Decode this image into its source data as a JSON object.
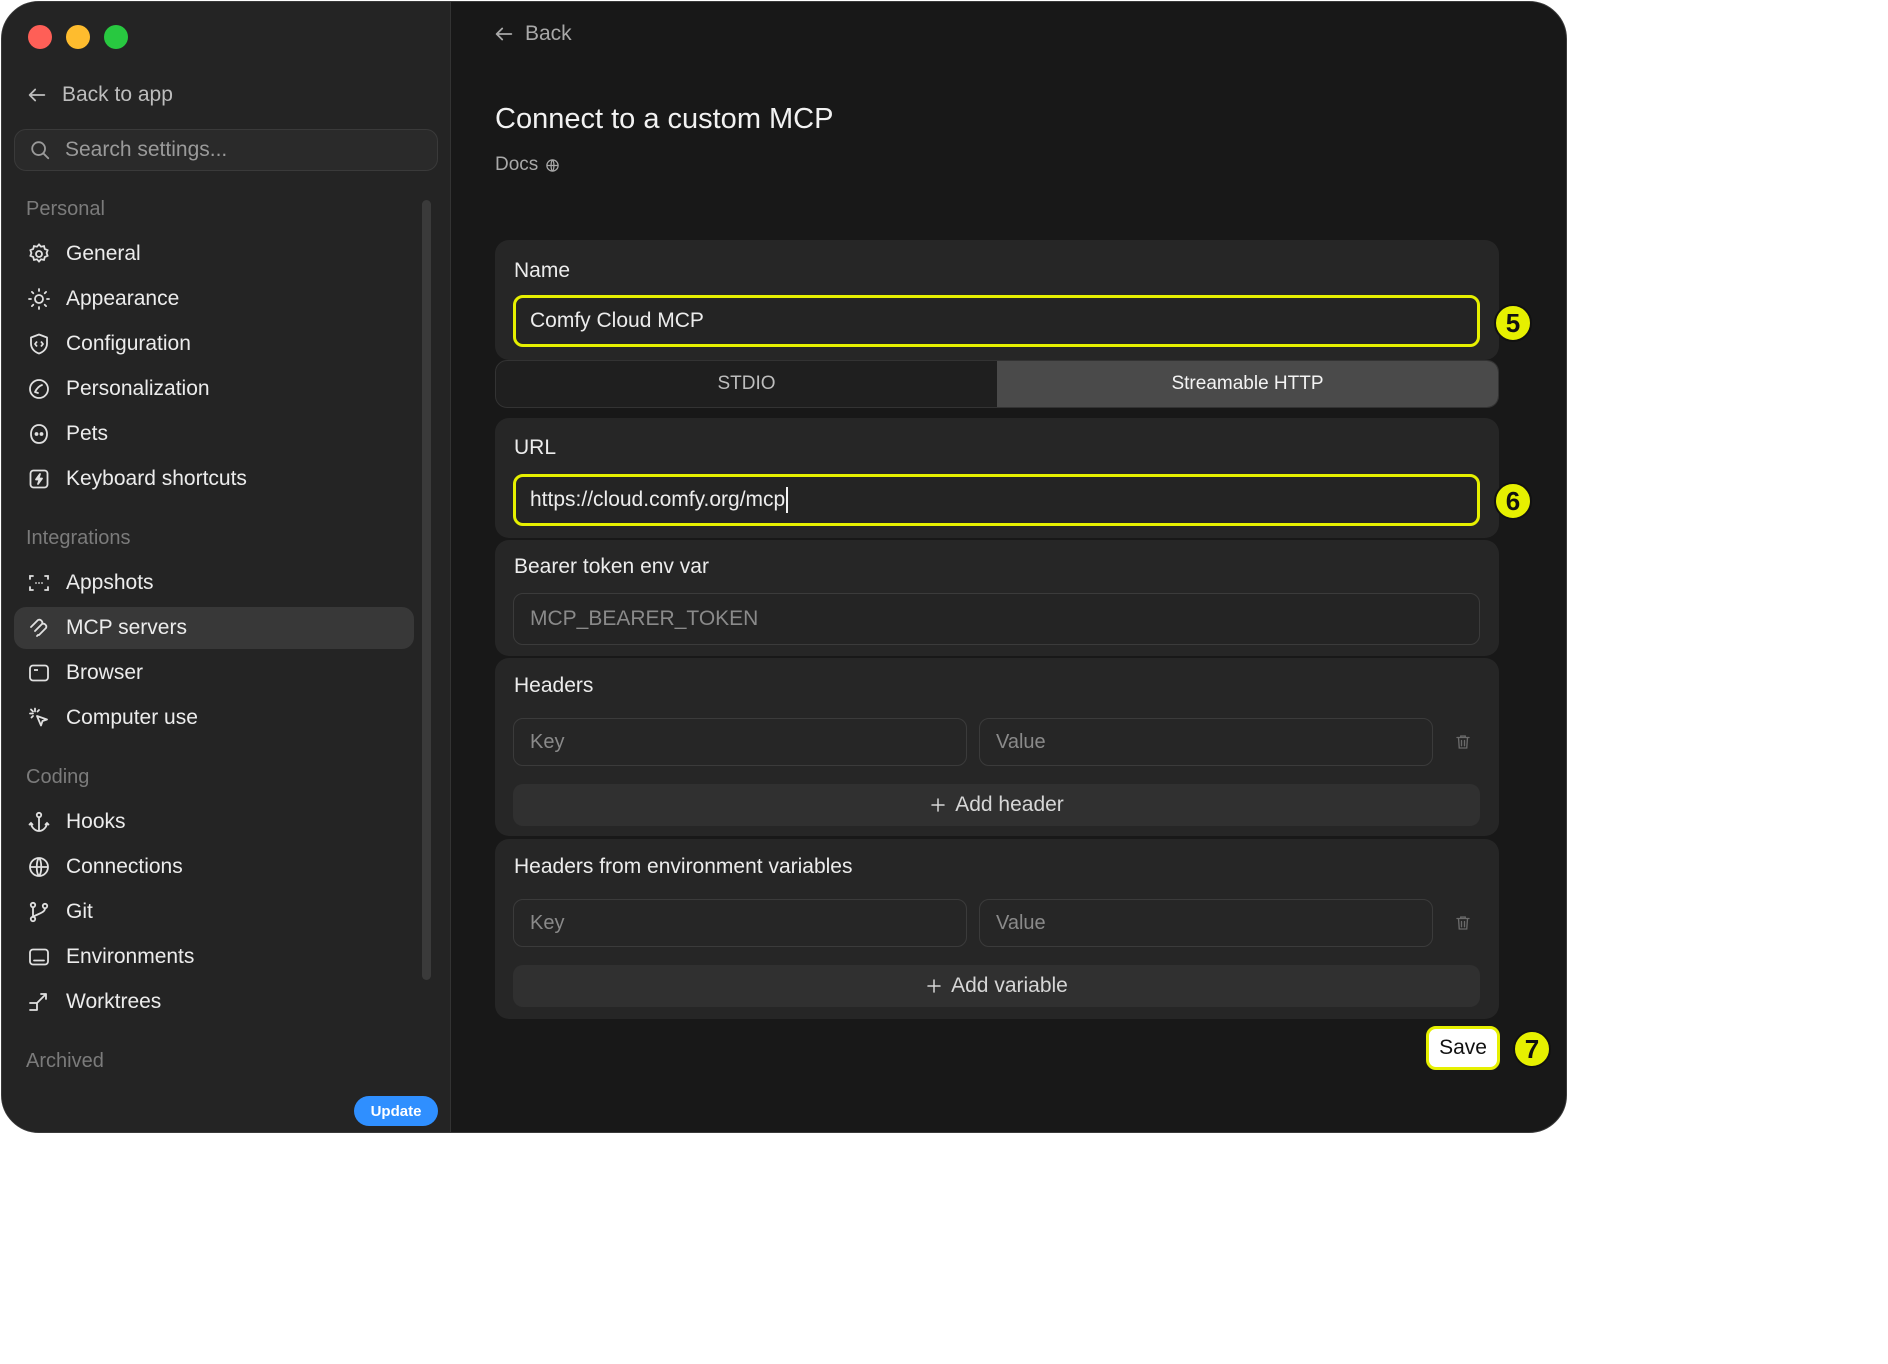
{
  "sidebar": {
    "back_to_app": "Back to app",
    "search_placeholder": "Search settings...",
    "sections": {
      "personal": "Personal",
      "integrations": "Integrations",
      "coding": "Coding",
      "archived": "Archived"
    },
    "personal_items": [
      {
        "label": "General",
        "icon": "gear-icon"
      },
      {
        "label": "Appearance",
        "icon": "sun-icon"
      },
      {
        "label": "Configuration",
        "icon": "shield-code-icon"
      },
      {
        "label": "Personalization",
        "icon": "personalization-icon"
      },
      {
        "label": "Pets",
        "icon": "pet-icon"
      },
      {
        "label": "Keyboard shortcuts",
        "icon": "keyboard-bolt-icon"
      }
    ],
    "integration_items": [
      {
        "label": "Appshots",
        "icon": "screenshot-frame-icon"
      },
      {
        "label": "MCP servers",
        "icon": "mcp-icon",
        "active": true
      },
      {
        "label": "Browser",
        "icon": "browser-window-icon"
      },
      {
        "label": "Computer use",
        "icon": "cursor-click-icon"
      }
    ],
    "coding_items": [
      {
        "label": "Hooks",
        "icon": "anchor-icon"
      },
      {
        "label": "Connections",
        "icon": "globe-icon"
      },
      {
        "label": "Git",
        "icon": "git-branch-icon"
      },
      {
        "label": "Environments",
        "icon": "laptop-icon"
      },
      {
        "label": "Worktrees",
        "icon": "worktree-icon"
      }
    ],
    "update_label": "Update",
    "update_color": "#2f8fff"
  },
  "main": {
    "back_label": "Back",
    "title": "Connect to a custom MCP",
    "docs_label": "Docs",
    "name": {
      "label": "Name",
      "value": "Comfy Cloud MCP"
    },
    "transport": {
      "options": [
        "STDIO",
        "Streamable HTTP"
      ],
      "selected": "Streamable HTTP"
    },
    "url": {
      "label": "URL",
      "value": "https://cloud.comfy.org/mcp"
    },
    "bearer": {
      "label": "Bearer token env var",
      "placeholder": "MCP_BEARER_TOKEN"
    },
    "headers": {
      "label": "Headers",
      "key_placeholder": "Key",
      "value_placeholder": "Value",
      "add_label": "Add header"
    },
    "env_headers": {
      "label": "Headers from environment variables",
      "key_placeholder": "Key",
      "value_placeholder": "Value",
      "add_label": "Add variable"
    },
    "save_label": "Save"
  },
  "annotations": {
    "name_step": "5",
    "url_step": "6",
    "save_step": "7",
    "highlight_color": "#e6f000"
  }
}
